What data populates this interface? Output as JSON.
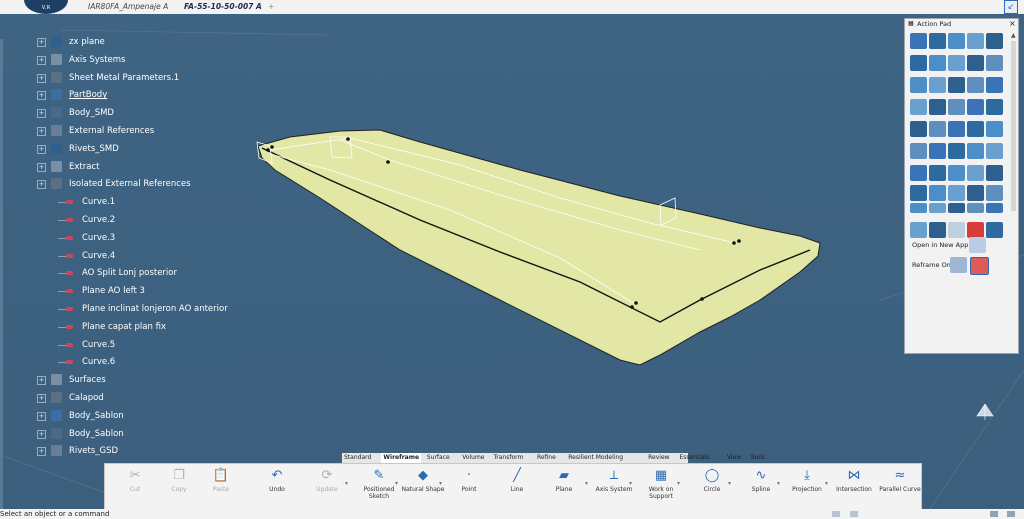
{
  "window": {
    "logo_text": "V,R",
    "tabs": [
      {
        "label": "IAR80FA_Ampenaje A"
      },
      {
        "label": "FA-55-10-50-007 A"
      }
    ],
    "add_tab": "+"
  },
  "tree": {
    "items": [
      {
        "label": "zx plane",
        "level": 1
      },
      {
        "label": "Axis Systems",
        "level": 1
      },
      {
        "label": "Sheet Metal Parameters.1",
        "level": 1
      },
      {
        "label": "PartBody",
        "level": 1
      },
      {
        "label": "Body_SMD",
        "level": 1
      },
      {
        "label": "External References",
        "level": 1
      },
      {
        "label": "Rivets_SMD",
        "level": 1
      },
      {
        "label": "Extract",
        "level": 1
      },
      {
        "label": "Isolated External References",
        "level": 1
      },
      {
        "label": "Curve.1",
        "level": 2
      },
      {
        "label": "Curve.2",
        "level": 2
      },
      {
        "label": "Curve.3",
        "level": 2
      },
      {
        "label": "Curve.4",
        "level": 2
      },
      {
        "label": "AO Split Lonj posterior",
        "level": 2
      },
      {
        "label": "Plane AO left 3",
        "level": 2
      },
      {
        "label": "Plane inclinat lonjeron AO anterior",
        "level": 2
      },
      {
        "label": "Plane capat plan fix",
        "level": 2
      },
      {
        "label": "Curve.5",
        "level": 2
      },
      {
        "label": "Curve.6",
        "level": 2
      },
      {
        "label": "Surfaces",
        "level": 1
      },
      {
        "label": "Calapod",
        "level": 1
      },
      {
        "label": "Body_Sablon",
        "level": 1
      },
      {
        "label": "Body_Sablon",
        "level": 1
      },
      {
        "label": "Rivets_GSD",
        "level": 1
      }
    ]
  },
  "action_pad": {
    "title": "Action Pad",
    "close": "×",
    "open_in_new_app": "Open in New App",
    "reframe_on": "Reframe On"
  },
  "workbench_tabs": [
    "Standard",
    "Wireframe",
    "Surface",
    "Volume",
    "Transform",
    "Refine",
    "Resilient Modeling",
    "Review",
    "Essentials",
    "View",
    "Tools"
  ],
  "active_tab": "Wireframe",
  "toolbar": {
    "tools": [
      {
        "label": "Cut",
        "icon": "scissors-icon",
        "disabled": true
      },
      {
        "label": "Copy",
        "icon": "copy-icon",
        "disabled": true
      },
      {
        "label": "Paste",
        "icon": "paste-icon",
        "disabled": true
      },
      {
        "label": "Undo",
        "icon": "undo-icon",
        "disabled": false
      },
      {
        "label": "Update",
        "icon": "update-icon",
        "disabled": true
      },
      {
        "label": "Positioned Sketch",
        "icon": "sketch-icon",
        "disabled": false
      },
      {
        "label": "Natural Shape",
        "icon": "natural-shape-icon",
        "disabled": false
      },
      {
        "label": "Point",
        "icon": "point-icon",
        "disabled": false
      },
      {
        "label": "Line",
        "icon": "line-icon",
        "disabled": false
      },
      {
        "label": "Plane",
        "icon": "plane-icon",
        "disabled": false
      },
      {
        "label": "Axis System",
        "icon": "axis-system-icon",
        "disabled": false
      },
      {
        "label": "Work on Support",
        "icon": "grid-icon",
        "disabled": false
      },
      {
        "label": "Circle",
        "icon": "circle-icon",
        "disabled": false
      },
      {
        "label": "Spline",
        "icon": "spline-icon",
        "disabled": false
      },
      {
        "label": "Projection",
        "icon": "projection-icon",
        "disabled": false
      },
      {
        "label": "Intersection",
        "icon": "intersection-icon",
        "disabled": false
      },
      {
        "label": "Parallel Curve",
        "icon": "parallel-curve-icon",
        "disabled": false
      }
    ]
  },
  "status": {
    "text": "Select an object or a command"
  },
  "colors": {
    "background": "#3d617f",
    "surface": "#e2e7a5",
    "accent": "#2b6bb3"
  }
}
